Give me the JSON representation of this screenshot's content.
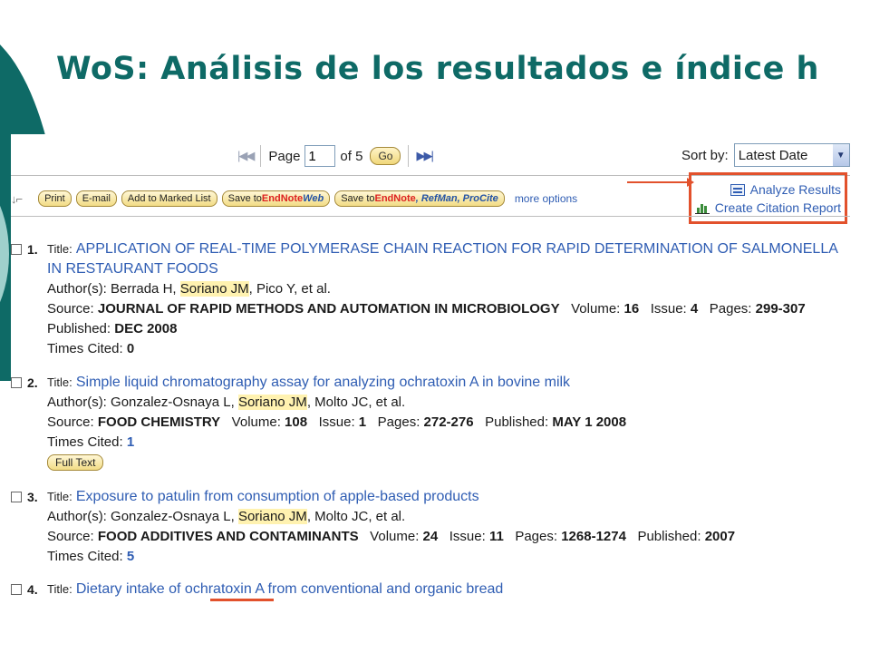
{
  "slide": {
    "title": "WoS: Análisis de los resultados e índice h"
  },
  "pager": {
    "prev_icon": "first-prev-icon",
    "page_label": "Page",
    "page_value": "1",
    "of_label": "of 5",
    "go_label": "Go",
    "next_icon": "next-last-icon"
  },
  "sort": {
    "label": "Sort by:",
    "selected": "Latest Date"
  },
  "toolbar": {
    "check_all_icon": "check-all-icon",
    "print": "Print",
    "email": "E-mail",
    "add_marked": "Add to Marked List",
    "save_endnote_prefix": "Save to ",
    "save_endnote_brand": "EndNote",
    "save_endnote_suffix": "Web",
    "save_multi_prefix": "Save to ",
    "save_multi_brand": "EndNote",
    "save_multi_suffix": ", RefMan, ProCite",
    "more_options": "more options"
  },
  "analyze": {
    "analyze_results": "Analyze Results",
    "citation_report": "Create Citation Report"
  },
  "colors": {
    "accent": "#e2512c",
    "link": "#2f5db3",
    "teal": "#0e6a66",
    "highlight": "#fff2b0"
  },
  "labels": {
    "title": "Title:",
    "authors": "Author(s):",
    "source": "Source:",
    "volume": "Volume:",
    "issue": "Issue:",
    "pages": "Pages:",
    "published": "Published:",
    "times_cited": "Times Cited:",
    "full_text": "Full Text"
  },
  "records": [
    {
      "num": "1.",
      "title": "APPLICATION OF REAL-TIME POLYMERASE CHAIN REACTION FOR RAPID DETERMINATION OF SALMONELLA IN RESTAURANT FOODS",
      "authors_pre": "Berrada H, ",
      "authors_hl": "Soriano JM",
      "authors_post": ", Pico Y, et al.",
      "source": "JOURNAL OF RAPID METHODS AND AUTOMATION IN MICROBIOLOGY",
      "volume": "16",
      "issue": "4",
      "pages": "299-307",
      "published": "DEC 2008",
      "times_cited": "0"
    },
    {
      "num": "2.",
      "title": "Simple liquid chromatography assay for analyzing ochratoxin A in bovine milk",
      "authors_pre": "Gonzalez-Osnaya L, ",
      "authors_hl": "Soriano JM",
      "authors_post": ", Molto JC, et al.",
      "source": "FOOD CHEMISTRY",
      "volume": "108",
      "issue": "1",
      "pages": "272-276",
      "published": "MAY 1 2008",
      "times_cited": "1"
    },
    {
      "num": "3.",
      "title": "Exposure to patulin from consumption of apple-based products",
      "authors_pre": "Gonzalez-Osnaya L, ",
      "authors_hl": "Soriano JM",
      "authors_post": ", Molto JC, et al.",
      "source": "FOOD ADDITIVES AND CONTAMINANTS",
      "volume": "24",
      "issue": "11",
      "pages": "1268-1274",
      "published": "2007",
      "times_cited": "5"
    },
    {
      "num": "4.",
      "title": "Dietary intake of ochratoxin A from conventional and organic bread"
    }
  ]
}
